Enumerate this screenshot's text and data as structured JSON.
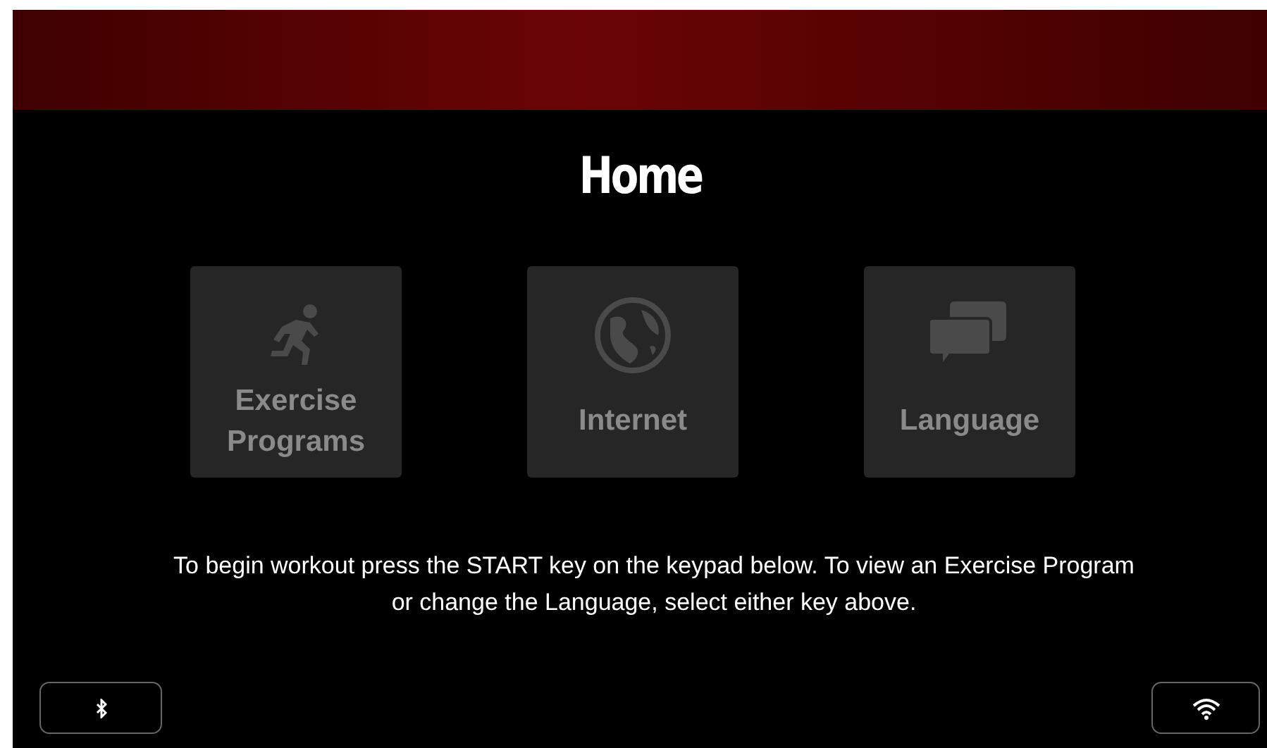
{
  "title": "Home",
  "tiles": [
    {
      "kind": "runner",
      "label": "Exercise Programs"
    },
    {
      "kind": "globe",
      "label": "Internet"
    },
    {
      "kind": "chat",
      "label": "Language"
    }
  ],
  "instructions": "To begin workout press the START key on the keypad below. To view an Exercise Program or change the Language, select either key above.",
  "bottom_buttons": [
    {
      "kind": "bluetooth"
    },
    {
      "kind": "wifi"
    }
  ]
}
